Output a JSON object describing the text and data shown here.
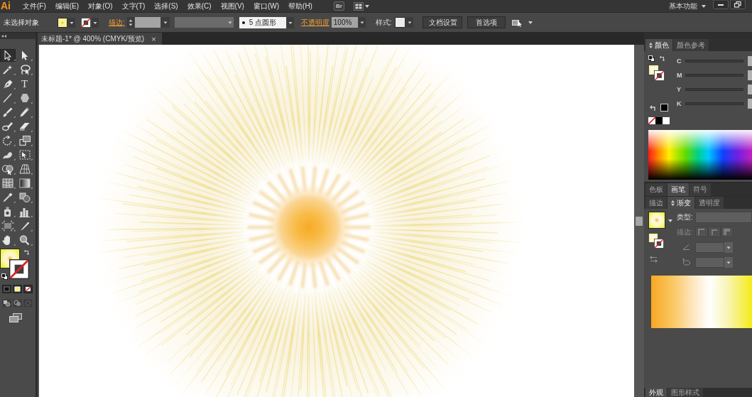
{
  "menu_bar": {
    "logo": "Ai",
    "menus": [
      "文件(F)",
      "编辑(E)",
      "对象(O)",
      "文字(T)",
      "选择(S)",
      "效果(C)",
      "视图(V)",
      "窗口(W)",
      "帮助(H)"
    ],
    "bridge_button": "Br",
    "workspace": "基本功能"
  },
  "control_bar": {
    "selection_status": "未选择对象",
    "stroke_label": "描边:",
    "brush": "5 点圆形",
    "opacity_label": "不透明度",
    "opacity": "100%",
    "style_label": "样式:",
    "buttons": [
      "文档设置",
      "首选项"
    ]
  },
  "document_tab": {
    "title": "未标题-1* @ 400% (CMYK/预览)",
    "close": "×"
  },
  "tools": [
    {
      "kind": "select",
      "selected": true
    },
    {
      "kind": "direct",
      "selected": false
    },
    {
      "kind": "wand",
      "selected": false
    },
    {
      "kind": "lasso",
      "selected": false
    },
    {
      "kind": "pen",
      "selected": false
    },
    {
      "kind": "type",
      "glyph": "T",
      "selected": false
    },
    {
      "kind": "line",
      "selected": false
    },
    {
      "kind": "polygon",
      "selected": false
    },
    {
      "kind": "brush",
      "selected": false
    },
    {
      "kind": "pencil",
      "selected": false
    },
    {
      "kind": "blob",
      "selected": false
    },
    {
      "kind": "eraser",
      "selected": false
    },
    {
      "kind": "rotate",
      "selected": false
    },
    {
      "kind": "scale",
      "selected": false
    },
    {
      "kind": "warp",
      "selected": false
    },
    {
      "kind": "transform",
      "selected": false
    },
    {
      "kind": "builder",
      "selected": false
    },
    {
      "kind": "perspective",
      "selected": false
    },
    {
      "kind": "mesh",
      "selected": false
    },
    {
      "kind": "gradient",
      "selected": false
    },
    {
      "kind": "eyedropper",
      "selected": false
    },
    {
      "kind": "blend",
      "selected": false
    },
    {
      "kind": "sprayer",
      "selected": false
    },
    {
      "kind": "graph",
      "selected": false
    },
    {
      "kind": "artboard",
      "selected": false
    },
    {
      "kind": "slice",
      "selected": false
    },
    {
      "kind": "hand",
      "selected": false
    },
    {
      "kind": "zoom",
      "selected": false
    }
  ],
  "color_panel": {
    "tabs": [
      {
        "label": "颜色",
        "selected": true
      },
      {
        "label": "颜色参考",
        "selected": false
      }
    ],
    "channels": [
      "C",
      "M",
      "Y",
      "K"
    ]
  },
  "swatch_group": {
    "tabs": [
      {
        "label": "色板",
        "selected": false
      },
      {
        "label": "画笔",
        "selected": true
      },
      {
        "label": "符号",
        "selected": false
      }
    ]
  },
  "gradient_panel": {
    "tabs": [
      {
        "label": "描边",
        "selected": false
      },
      {
        "label": "渐变",
        "selected": true
      },
      {
        "label": "透明度",
        "selected": false
      }
    ],
    "type_label": "类型:",
    "stroke": {
      "label": "描边:",
      "disabled": true
    }
  },
  "appearance_group": {
    "tabs": [
      {
        "label": "外观",
        "selected": true
      },
      {
        "label": "图形样式",
        "selected": false
      }
    ]
  }
}
